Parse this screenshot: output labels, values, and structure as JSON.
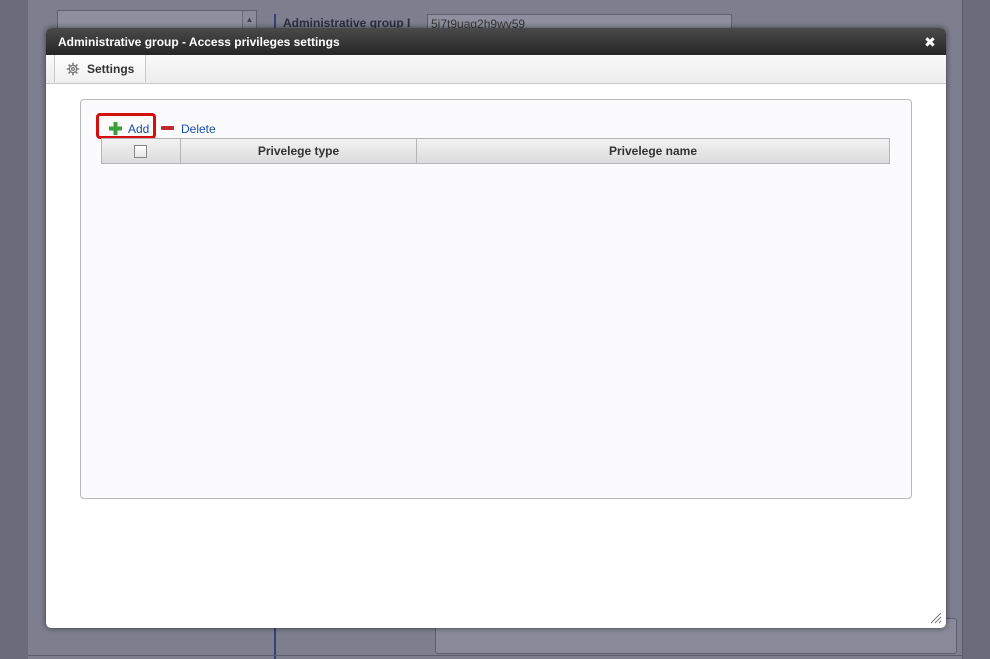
{
  "background": {
    "field_label": "Administrative group I",
    "field_value": "5i7t9uag2h9wv59"
  },
  "dialog": {
    "title": "Administrative group - Access privileges settings",
    "close_symbol": "✖"
  },
  "tabs": [
    {
      "label": "Settings",
      "icon": "gear-icon"
    }
  ],
  "toolbar": {
    "add_label": "Add",
    "delete_label": "Delete"
  },
  "grid": {
    "columns": [
      "",
      "Privelege type",
      "Privelege name"
    ],
    "rows": []
  },
  "colors": {
    "highlight": "#d40f0f",
    "link": "#1a4fa0",
    "add_icon": "#3aa03a",
    "delete_icon": "#c22b2b"
  }
}
